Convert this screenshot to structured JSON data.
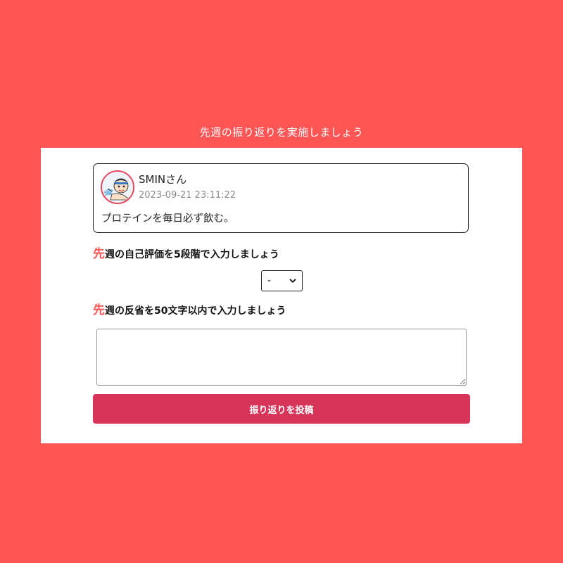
{
  "header": {
    "title": "先週の振り返りを実施しましょう"
  },
  "post": {
    "username": "SMINさん",
    "timestamp": "2023-09-21 23:11:22",
    "body": "プロテインを毎日必ず飲む。"
  },
  "rating_section": {
    "label_accent": "先",
    "label_rest": "週の自己評価を5段階で入力しましょう",
    "selected_value": "-"
  },
  "reflection_section": {
    "label_accent": "先",
    "label_rest": "週の反省を50文字以内で入力しましょう",
    "value": ""
  },
  "submit": {
    "label": "振り返りを投稿"
  },
  "colors": {
    "background": "#ff5555",
    "accent": "#ff5555",
    "button": "#d63559",
    "avatar_border": "#e8485c"
  }
}
